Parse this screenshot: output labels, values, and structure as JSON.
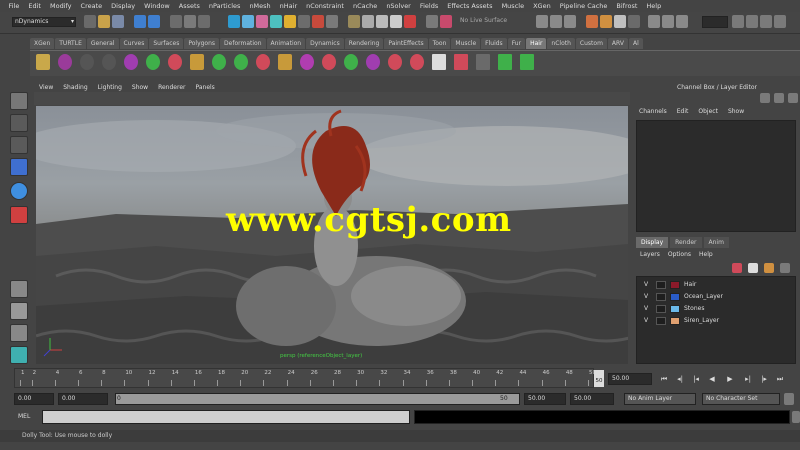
{
  "menubar": [
    "File",
    "Edit",
    "Modify",
    "Create",
    "Display",
    "Window",
    "Assets",
    "nParticles",
    "nMesh",
    "nHair",
    "nConstraint",
    "nCache",
    "nSolver",
    "Fields",
    "Effects Assets",
    "Muscle",
    "XGen",
    "Pipeline Cache",
    "Bifrost",
    "Help"
  ],
  "status": {
    "mode": "nDynamics",
    "live_surface": "No Live Surface"
  },
  "shelf_tabs": [
    "XGen",
    "TURTLE",
    "General",
    "Curves",
    "Surfaces",
    "Polygons",
    "Deformation",
    "Animation",
    "Dynamics",
    "Rendering",
    "PaintEffects",
    "Toon",
    "Muscle",
    "Fluids",
    "Fur",
    "Hair",
    "nCloth",
    "Custom",
    "ARV",
    "Al"
  ],
  "shelf_active_tab": "Hair",
  "viewport": {
    "menu": [
      "View",
      "Shading",
      "Lighting",
      "Show",
      "Renderer",
      "Panels"
    ],
    "camera_label": "persp (referenceObject_layer)",
    "watermark": "www.cgtsj.com"
  },
  "channel_box": {
    "title": "Channel Box / Layer Editor",
    "menu": [
      "Channels",
      "Edit",
      "Object",
      "Show"
    ]
  },
  "layer_editor": {
    "tabs": [
      "Display",
      "Render",
      "Anim"
    ],
    "active_tab": "Display",
    "menu": [
      "Layers",
      "Options",
      "Help"
    ],
    "layers": [
      {
        "vis": "V",
        "name": "Hair",
        "color": "#8b1a2a"
      },
      {
        "vis": "V",
        "name": "Ocean_Layer",
        "color": "#2a5cc8"
      },
      {
        "vis": "V",
        "name": "Stones",
        "color": "#6ab8e8"
      },
      {
        "vis": "V",
        "name": "Siren_Layer",
        "color": "#e0a070"
      }
    ]
  },
  "timeline": {
    "ticks": [
      "1",
      "2",
      "4",
      "6",
      "8",
      "10",
      "12",
      "14",
      "16",
      "18",
      "20",
      "22",
      "24",
      "26",
      "28",
      "30",
      "32",
      "34",
      "36",
      "38",
      "40",
      "42",
      "44",
      "46",
      "48",
      "50"
    ],
    "end_marker": "50",
    "current_time": "50.00"
  },
  "range": {
    "start_time": "0.00",
    "playback_start": "0.00",
    "range_start": "0",
    "range_end": "50",
    "playback_end": "50.00",
    "end_time": "50.00",
    "anim_layer": "No Anim Layer",
    "char_set": "No Character Set"
  },
  "command_line": {
    "label": "MEL"
  },
  "help_line": "Dolly Tool: Use mouse to dolly"
}
